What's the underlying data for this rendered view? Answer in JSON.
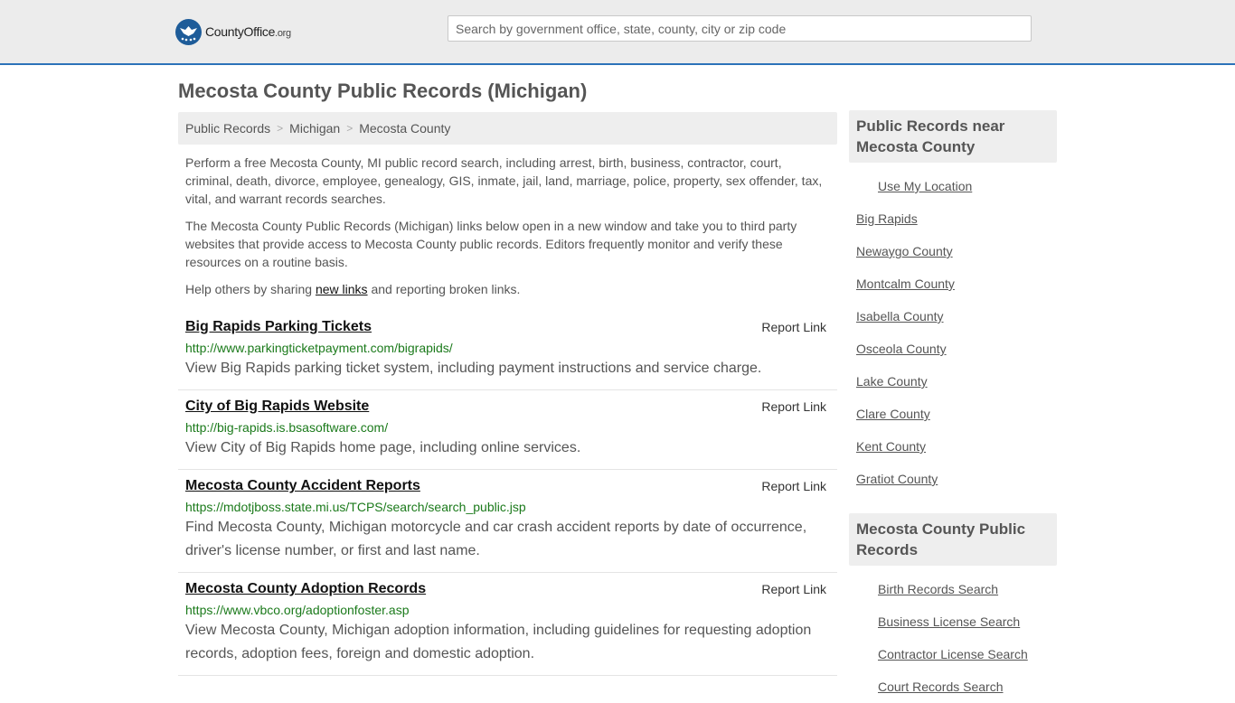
{
  "header": {
    "logo_text": "CountyOffice",
    "logo_suffix": ".org",
    "search_placeholder": "Search by government office, state, county, city or zip code"
  },
  "page_title": "Mecosta County Public Records (Michigan)",
  "breadcrumb": [
    "Public Records",
    "Michigan",
    "Mecosta County"
  ],
  "intro": {
    "p1": "Perform a free Mecosta County, MI public record search, including arrest, birth, business, contractor, court, criminal, death, divorce, employee, genealogy, GIS, inmate, jail, land, marriage, police, property, sex offender, tax, vital, and warrant records searches.",
    "p2": "The Mecosta County Public Records (Michigan) links below open in a new window and take you to third party websites that provide access to Mecosta County public records. Editors frequently monitor and verify these resources on a routine basis.",
    "p3_before": "Help others by sharing ",
    "p3_link": "new links",
    "p3_after": " and reporting broken links."
  },
  "report_label": "Report Link",
  "records": [
    {
      "title": "Big Rapids Parking Tickets",
      "url": "http://www.parkingticketpayment.com/bigrapids/",
      "desc": "View Big Rapids parking ticket system, including payment instructions and service charge."
    },
    {
      "title": "City of Big Rapids Website",
      "url": "http://big-rapids.is.bsasoftware.com/",
      "desc": "View City of Big Rapids home page, including online services."
    },
    {
      "title": "Mecosta County Accident Reports",
      "url": "https://mdotjboss.state.mi.us/TCPS/search/search_public.jsp",
      "desc": "Find Mecosta County, Michigan motorcycle and car crash accident reports by date of occurrence, driver's license number, or first and last name."
    },
    {
      "title": "Mecosta County Adoption Records",
      "url": "https://www.vbco.org/adoptionfoster.asp",
      "desc": "View Mecosta County, Michigan adoption information, including guidelines for requesting adoption records, adoption fees, foreign and domestic adoption."
    }
  ],
  "sidebar": {
    "near_title": "Public Records near Mecosta County",
    "use_location": "Use My Location",
    "near_items": [
      "Big Rapids",
      "Newaygo County",
      "Montcalm County",
      "Isabella County",
      "Osceola County",
      "Lake County",
      "Clare County",
      "Kent County",
      "Gratiot County"
    ],
    "county_title": "Mecosta County Public Records",
    "county_items": [
      "Birth Records Search",
      "Business License Search",
      "Contractor License Search",
      "Court Records Search"
    ]
  },
  "colors": {
    "accent": "#2c73b9",
    "url_green": "#1b7a1b",
    "panel_grey": "#eeeeee"
  }
}
